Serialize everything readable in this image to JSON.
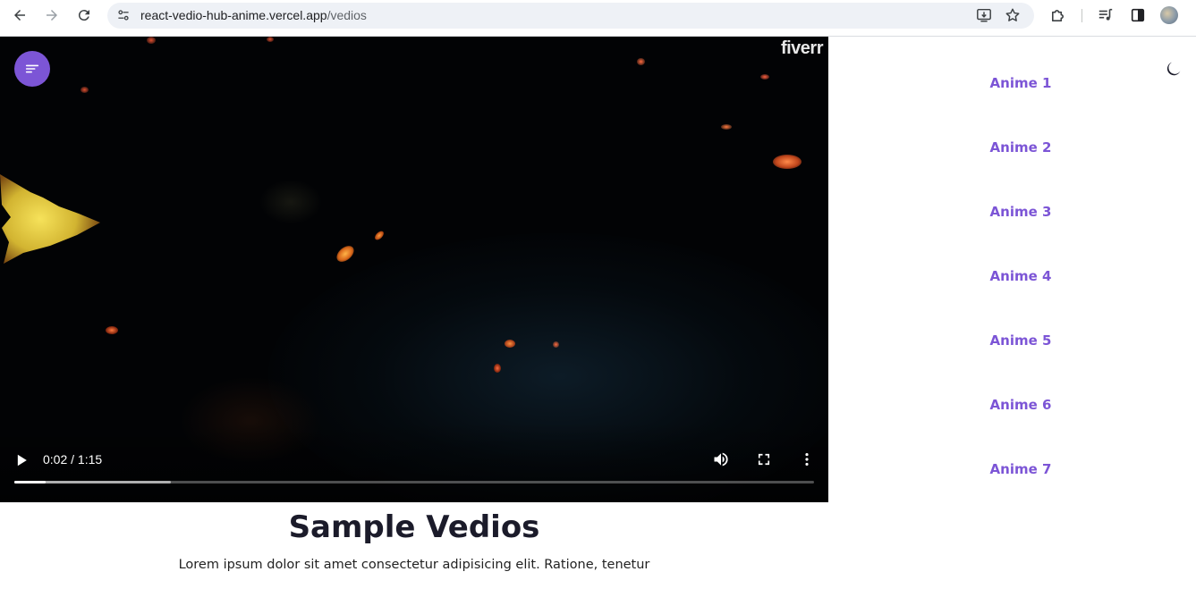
{
  "browser": {
    "url_host": "react-vedio-hub-anime.vercel.app",
    "url_path": "/vedios"
  },
  "video": {
    "watermark": "fiverr",
    "time_display": "0:02 / 1:15",
    "played_fraction": 0.039,
    "buffered_fraction": 0.196
  },
  "sidebar": {
    "items": [
      {
        "label": "Anime 1"
      },
      {
        "label": "Anime 2"
      },
      {
        "label": "Anime 3"
      },
      {
        "label": "Anime 4"
      },
      {
        "label": "Anime 5"
      },
      {
        "label": "Anime 6"
      },
      {
        "label": "Anime 7"
      }
    ]
  },
  "main": {
    "title": "Sample Vedios",
    "description": "Lorem ipsum dolor sit amet consectetur adipisicing elit. Ratione, tenetur"
  },
  "colors": {
    "accent": "#7c55d6",
    "video_bg": "#020305"
  },
  "icons": {
    "back": "arrow-left-icon",
    "forward": "arrow-right-icon",
    "reload": "reload-icon",
    "site_info": "tune-icon",
    "install": "install-app-icon",
    "bookmark": "star-icon",
    "extensions": "puzzle-icon",
    "media": "media-queue-icon",
    "side_panel": "side-panel-icon",
    "menu": "sort-lines-icon",
    "theme": "moon-icon",
    "play": "play-icon",
    "volume": "volume-icon",
    "fullscreen": "fullscreen-icon",
    "more": "more-vertical-icon"
  }
}
